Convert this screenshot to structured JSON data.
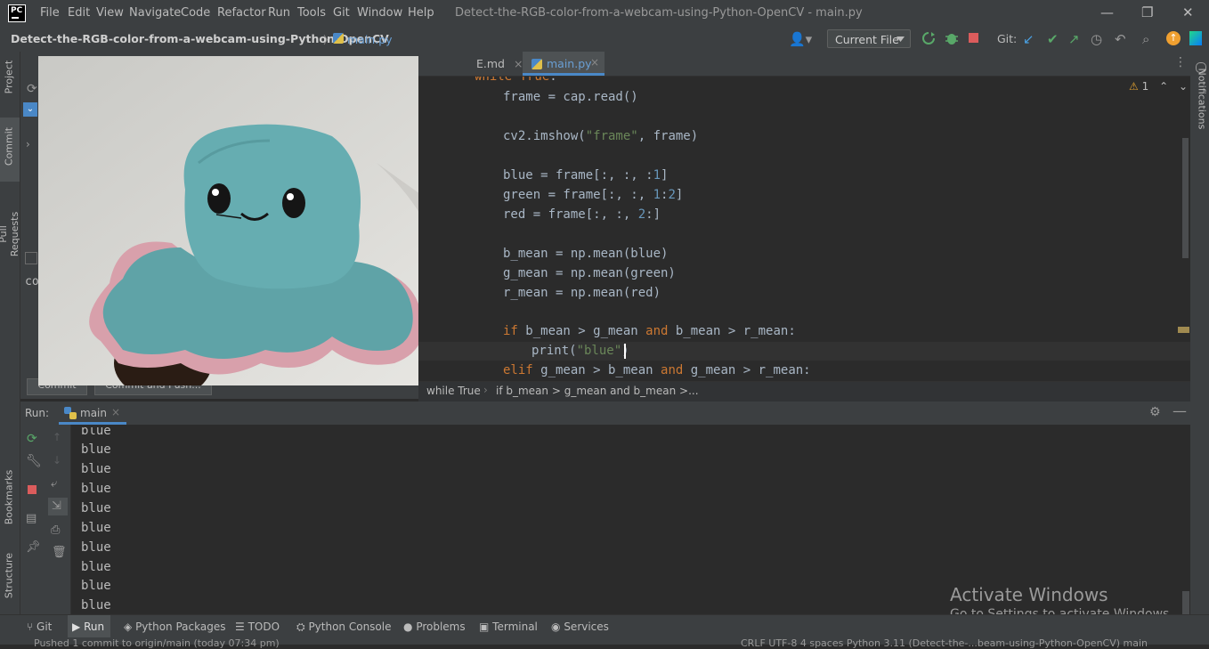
{
  "titlebar": {
    "logo": "PC",
    "menus": [
      "File",
      "Edit",
      "View",
      "Navigate",
      "Code",
      "Refactor",
      "Run",
      "Tools",
      "Git",
      "Window",
      "Help"
    ],
    "window_title": "Detect-the-RGB-color-from-a-webcam-using-Python-OpenCV - main.py",
    "minimize_glyph": "—",
    "restore_glyph": "❐",
    "close_glyph": "✕"
  },
  "navbar": {
    "project_name": "Detect-the-RGB-color-from-a-webcam-using-Python-OpenCV",
    "file_name": "main.py",
    "run_configuration": "Current File",
    "git_label": "Git:"
  },
  "left_stripe": [
    "Project",
    "Commit",
    "Pull Requests",
    "Bookmarks",
    "Structure"
  ],
  "right_stripe": [
    "Notifications"
  ],
  "commit_panel": {
    "partial_text": "co",
    "commit_button": "Commit",
    "commit_push_button": "Commit and Push..."
  },
  "camera_window": {
    "subject": "plush-octopus-image"
  },
  "editor": {
    "tabs": [
      {
        "label": "E.md",
        "active": false
      },
      {
        "label": "main.py",
        "active": true
      }
    ],
    "warning_count": "1",
    "code_lines": [
      "while True:",
      "    frame = cap.read()",
      "",
      "    cv2.imshow(\"frame\", frame)",
      "",
      "    blue = frame[:, :, :1]",
      "    green = frame[:, :, 1:2]",
      "    red = frame[:, :, 2:]",
      "",
      "    b_mean = np.mean(blue)",
      "    g_mean = np.mean(green)",
      "    r_mean = np.mean(red)",
      "",
      "    if b_mean > g_mean and b_mean > r_mean:",
      "        print(\"blue\")",
      "    elif g_mean > b_mean and g_mean > r_mean:"
    ],
    "breadcrumb": [
      "while True",
      "if b_mean > g_mean and b_mean >..."
    ]
  },
  "run_window": {
    "label": "Run:",
    "tab": "main",
    "output": [
      "blue",
      "blue",
      "blue",
      "blue",
      "blue",
      "blue",
      "blue",
      "blue",
      "blue",
      "blue"
    ]
  },
  "bottom_tools": [
    "Git",
    "Run",
    "Python Packages",
    "TODO",
    "Python Console",
    "Problems",
    "Terminal",
    "Services"
  ],
  "statusbar": {
    "message": "Pushed 1 commit to origin/main (today 07:34 pm)",
    "right": "CRLF   UTF-8   4 spaces   Python 3.11 (Detect-the-...beam-using-Python-OpenCV)   main"
  },
  "watermark": {
    "line1": "Activate Windows",
    "line2": "Go to Settings to activate Windows."
  },
  "colors": {
    "background": "#2b2b2b",
    "panel": "#3c3f41",
    "keyword": "#cc7832",
    "string": "#6a8759",
    "number": "#6897bb",
    "accent": "#4a88c7"
  }
}
